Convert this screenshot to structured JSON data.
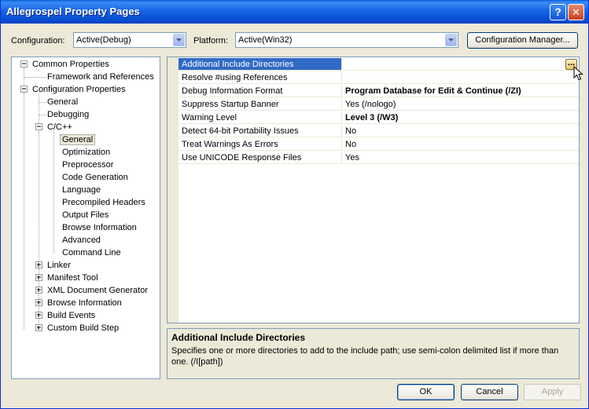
{
  "window": {
    "title": "Allegrospel Property Pages",
    "help_glyph": "?",
    "close_glyph": "✕"
  },
  "top": {
    "configuration_label": "Configuration:",
    "configuration_value": "Active(Debug)",
    "platform_label": "Platform:",
    "platform_value": "Active(Win32)",
    "manager_button": "Configuration Manager..."
  },
  "tree": [
    "Common Properties",
    "Framework and References",
    "Configuration Properties",
    "General",
    "Debugging",
    "C/C++",
    "General",
    "Optimization",
    "Preprocessor",
    "Code Generation",
    "Language",
    "Precompiled Headers",
    "Output Files",
    "Browse Information",
    "Advanced",
    "Command Line",
    "Linker",
    "Manifest Tool",
    "XML Document Generator",
    "Browse Information",
    "Build Events",
    "Custom Build Step"
  ],
  "properties": [
    {
      "name": "Additional Include Directories",
      "value": ""
    },
    {
      "name": "Resolve #using References",
      "value": ""
    },
    {
      "name": "Debug Information Format",
      "value": "Program Database for Edit & Continue (/ZI)"
    },
    {
      "name": "Suppress Startup Banner",
      "value": "Yes (/nologo)"
    },
    {
      "name": "Warning Level",
      "value": "Level 3 (/W3)"
    },
    {
      "name": "Detect 64-bit Portability Issues",
      "value": "No"
    },
    {
      "name": "Treat Warnings As Errors",
      "value": "No"
    },
    {
      "name": "Use UNICODE Response Files",
      "value": "Yes"
    }
  ],
  "ellipsis_label": "...",
  "description": {
    "title": "Additional Include Directories",
    "text": "Specifies one or more directories to add to the include path; use semi-colon delimited list if more than one. (/I[path])"
  },
  "buttons": {
    "ok": "OK",
    "cancel": "Cancel",
    "apply": "Apply"
  }
}
